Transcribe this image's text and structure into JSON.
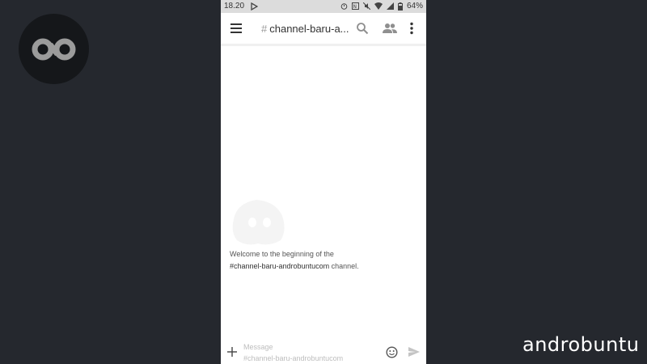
{
  "statusbar": {
    "time": "18.20",
    "battery": "64%"
  },
  "header": {
    "hash": "#",
    "channel_title": "channel-baru-a..."
  },
  "welcome": {
    "line1": "Welcome to the beginning of the",
    "channel": "#channel-baru-androbuntucom",
    "suffix": " channel."
  },
  "composer": {
    "placeholder_line1": "Message",
    "placeholder_line2": "#channel-baru-androbuntucom"
  },
  "watermark": {
    "text": "androbuntu"
  },
  "colors": {
    "background": "#25282e",
    "statusbar": "#dcdcdc",
    "icon": "#9aa0a6"
  },
  "icons": [
    "menu-icon",
    "search-icon",
    "members-icon",
    "more-icon",
    "plus-icon",
    "emoji-icon",
    "send-icon",
    "discord-logo"
  ]
}
